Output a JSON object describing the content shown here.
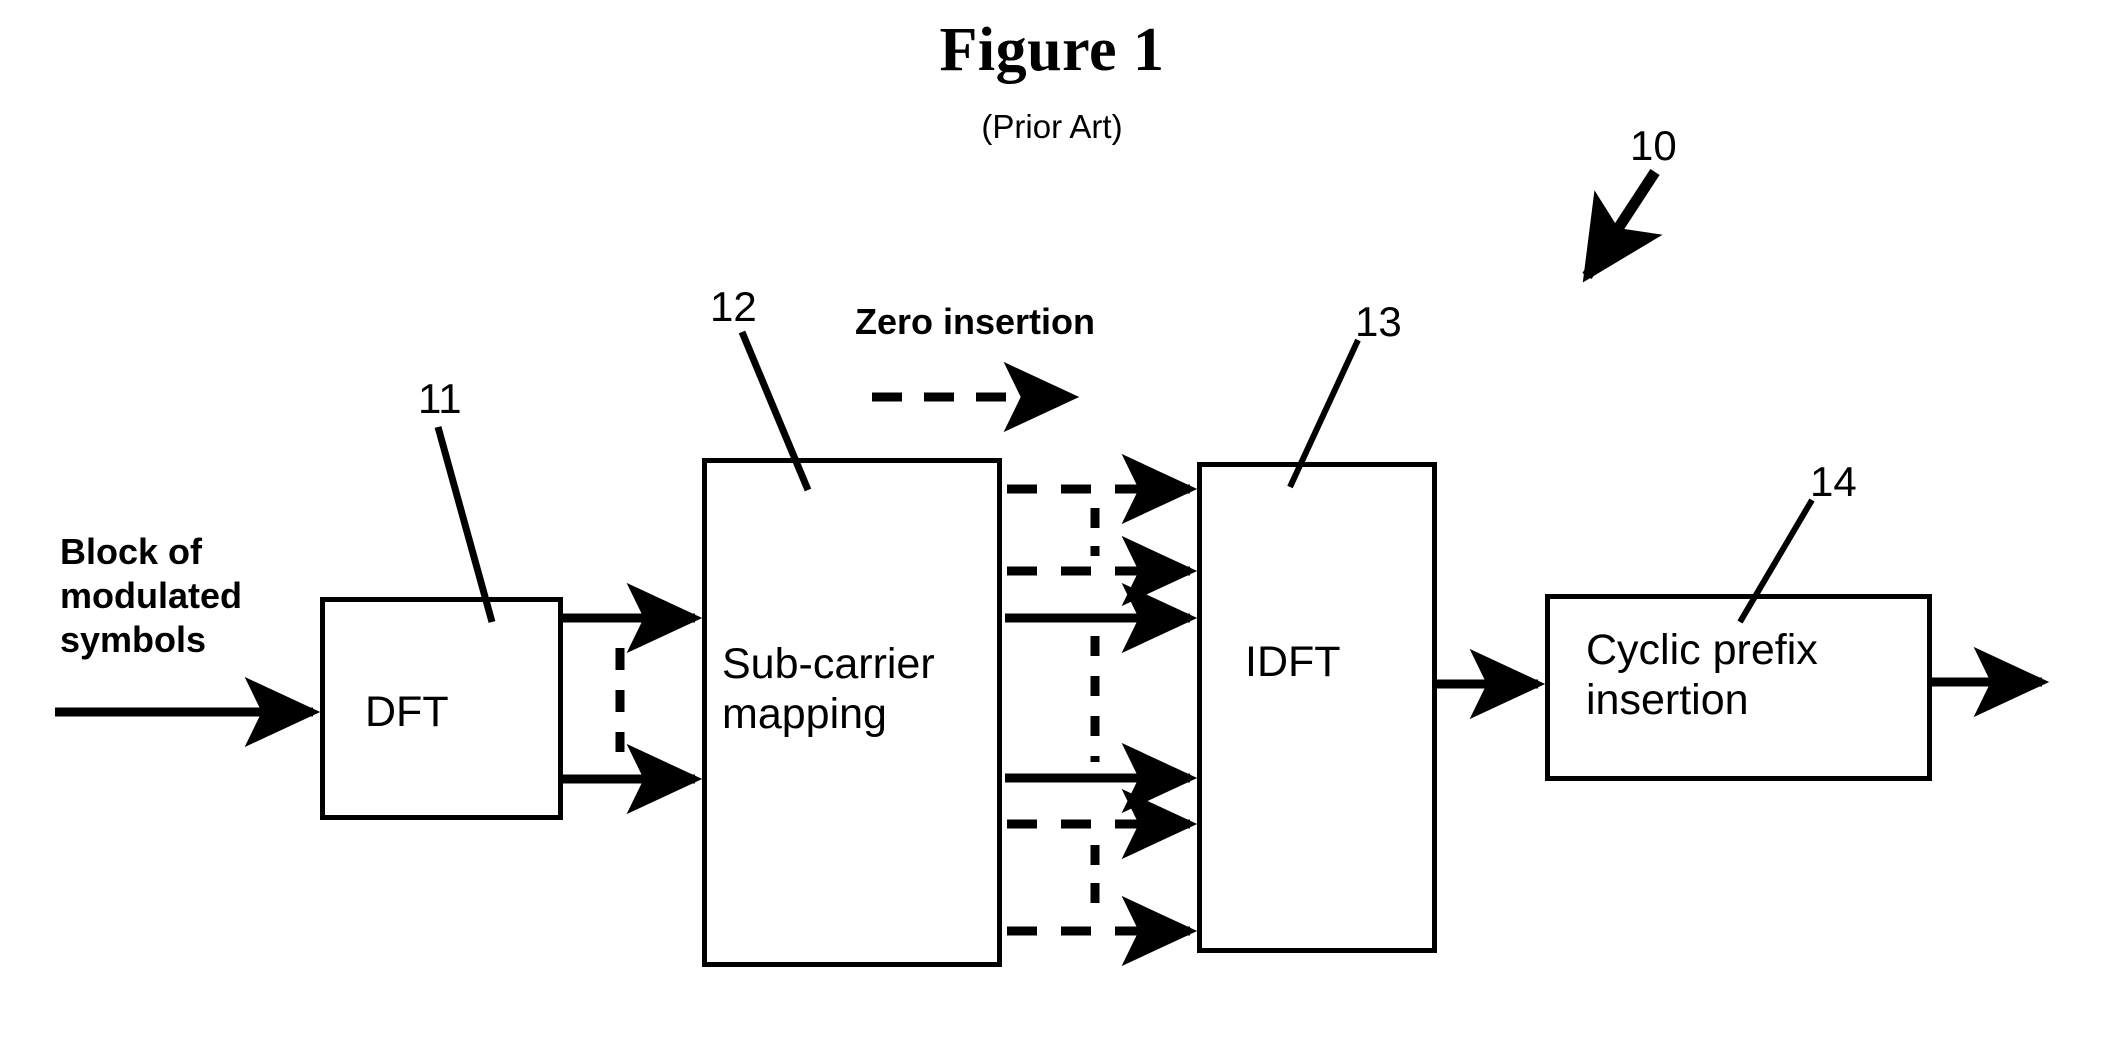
{
  "figure": {
    "title": "Figure 1",
    "subtitle": "(Prior Art)"
  },
  "labels": {
    "input_text_line1": "Block of",
    "input_text_line2": "modulated",
    "input_text_line3": "symbols",
    "zero_insertion": "Zero insertion"
  },
  "blocks": [
    {
      "id": "dft",
      "label_line1": "DFT",
      "label_line2": "",
      "ref": "11"
    },
    {
      "id": "subcarrier",
      "label_line1": "Sub-carrier",
      "label_line2": "mapping",
      "ref": "12"
    },
    {
      "id": "idft",
      "label_line1": "IDFT",
      "label_line2": "",
      "ref": "13"
    },
    {
      "id": "cyclicprefix",
      "label_line1": "Cyclic prefix",
      "label_line2": "insertion",
      "ref": "14"
    }
  ],
  "reference_numerals": {
    "system": "10",
    "dft": "11",
    "subcarrier_mapping": "12",
    "idft": "13",
    "cyclic_prefix_insertion": "14"
  },
  "colors": {
    "ink": "#000000",
    "paper": "#ffffff"
  }
}
